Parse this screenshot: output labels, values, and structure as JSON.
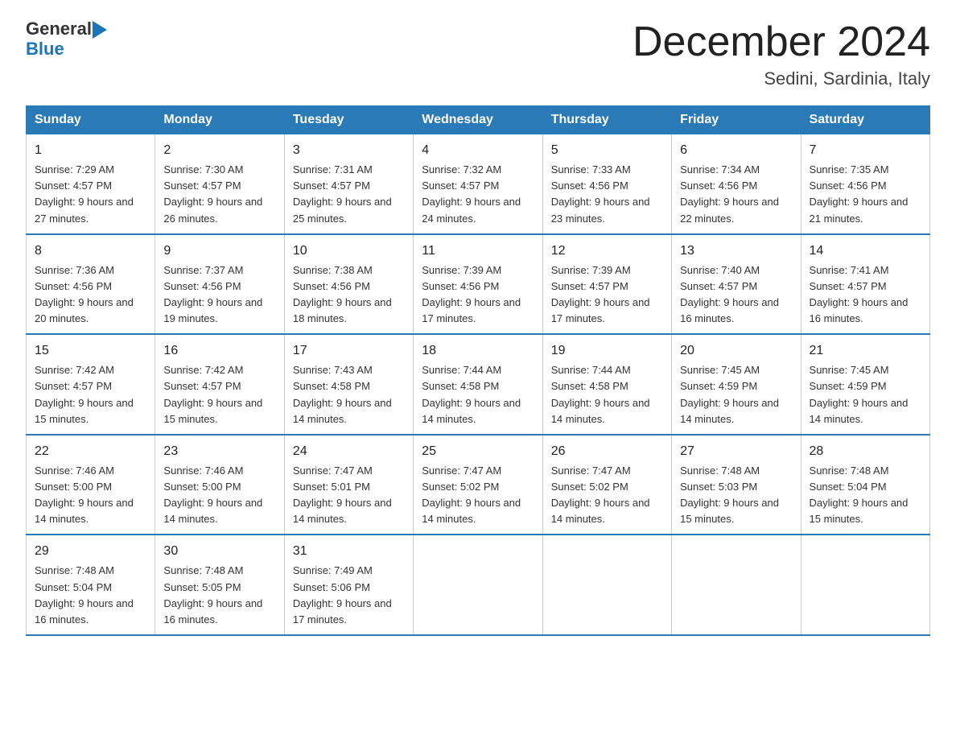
{
  "logo": {
    "general": "General",
    "blue": "Blue",
    "arrow": "▶"
  },
  "title": "December 2024",
  "subtitle": "Sedini, Sardinia, Italy",
  "weekdays": [
    "Sunday",
    "Monday",
    "Tuesday",
    "Wednesday",
    "Thursday",
    "Friday",
    "Saturday"
  ],
  "weeks": [
    [
      {
        "day": "1",
        "sunrise": "Sunrise: 7:29 AM",
        "sunset": "Sunset: 4:57 PM",
        "daylight": "Daylight: 9 hours and 27 minutes."
      },
      {
        "day": "2",
        "sunrise": "Sunrise: 7:30 AM",
        "sunset": "Sunset: 4:57 PM",
        "daylight": "Daylight: 9 hours and 26 minutes."
      },
      {
        "day": "3",
        "sunrise": "Sunrise: 7:31 AM",
        "sunset": "Sunset: 4:57 PM",
        "daylight": "Daylight: 9 hours and 25 minutes."
      },
      {
        "day": "4",
        "sunrise": "Sunrise: 7:32 AM",
        "sunset": "Sunset: 4:57 PM",
        "daylight": "Daylight: 9 hours and 24 minutes."
      },
      {
        "day": "5",
        "sunrise": "Sunrise: 7:33 AM",
        "sunset": "Sunset: 4:56 PM",
        "daylight": "Daylight: 9 hours and 23 minutes."
      },
      {
        "day": "6",
        "sunrise": "Sunrise: 7:34 AM",
        "sunset": "Sunset: 4:56 PM",
        "daylight": "Daylight: 9 hours and 22 minutes."
      },
      {
        "day": "7",
        "sunrise": "Sunrise: 7:35 AM",
        "sunset": "Sunset: 4:56 PM",
        "daylight": "Daylight: 9 hours and 21 minutes."
      }
    ],
    [
      {
        "day": "8",
        "sunrise": "Sunrise: 7:36 AM",
        "sunset": "Sunset: 4:56 PM",
        "daylight": "Daylight: 9 hours and 20 minutes."
      },
      {
        "day": "9",
        "sunrise": "Sunrise: 7:37 AM",
        "sunset": "Sunset: 4:56 PM",
        "daylight": "Daylight: 9 hours and 19 minutes."
      },
      {
        "day": "10",
        "sunrise": "Sunrise: 7:38 AM",
        "sunset": "Sunset: 4:56 PM",
        "daylight": "Daylight: 9 hours and 18 minutes."
      },
      {
        "day": "11",
        "sunrise": "Sunrise: 7:39 AM",
        "sunset": "Sunset: 4:56 PM",
        "daylight": "Daylight: 9 hours and 17 minutes."
      },
      {
        "day": "12",
        "sunrise": "Sunrise: 7:39 AM",
        "sunset": "Sunset: 4:57 PM",
        "daylight": "Daylight: 9 hours and 17 minutes."
      },
      {
        "day": "13",
        "sunrise": "Sunrise: 7:40 AM",
        "sunset": "Sunset: 4:57 PM",
        "daylight": "Daylight: 9 hours and 16 minutes."
      },
      {
        "day": "14",
        "sunrise": "Sunrise: 7:41 AM",
        "sunset": "Sunset: 4:57 PM",
        "daylight": "Daylight: 9 hours and 16 minutes."
      }
    ],
    [
      {
        "day": "15",
        "sunrise": "Sunrise: 7:42 AM",
        "sunset": "Sunset: 4:57 PM",
        "daylight": "Daylight: 9 hours and 15 minutes."
      },
      {
        "day": "16",
        "sunrise": "Sunrise: 7:42 AM",
        "sunset": "Sunset: 4:57 PM",
        "daylight": "Daylight: 9 hours and 15 minutes."
      },
      {
        "day": "17",
        "sunrise": "Sunrise: 7:43 AM",
        "sunset": "Sunset: 4:58 PM",
        "daylight": "Daylight: 9 hours and 14 minutes."
      },
      {
        "day": "18",
        "sunrise": "Sunrise: 7:44 AM",
        "sunset": "Sunset: 4:58 PM",
        "daylight": "Daylight: 9 hours and 14 minutes."
      },
      {
        "day": "19",
        "sunrise": "Sunrise: 7:44 AM",
        "sunset": "Sunset: 4:58 PM",
        "daylight": "Daylight: 9 hours and 14 minutes."
      },
      {
        "day": "20",
        "sunrise": "Sunrise: 7:45 AM",
        "sunset": "Sunset: 4:59 PM",
        "daylight": "Daylight: 9 hours and 14 minutes."
      },
      {
        "day": "21",
        "sunrise": "Sunrise: 7:45 AM",
        "sunset": "Sunset: 4:59 PM",
        "daylight": "Daylight: 9 hours and 14 minutes."
      }
    ],
    [
      {
        "day": "22",
        "sunrise": "Sunrise: 7:46 AM",
        "sunset": "Sunset: 5:00 PM",
        "daylight": "Daylight: 9 hours and 14 minutes."
      },
      {
        "day": "23",
        "sunrise": "Sunrise: 7:46 AM",
        "sunset": "Sunset: 5:00 PM",
        "daylight": "Daylight: 9 hours and 14 minutes."
      },
      {
        "day": "24",
        "sunrise": "Sunrise: 7:47 AM",
        "sunset": "Sunset: 5:01 PM",
        "daylight": "Daylight: 9 hours and 14 minutes."
      },
      {
        "day": "25",
        "sunrise": "Sunrise: 7:47 AM",
        "sunset": "Sunset: 5:02 PM",
        "daylight": "Daylight: 9 hours and 14 minutes."
      },
      {
        "day": "26",
        "sunrise": "Sunrise: 7:47 AM",
        "sunset": "Sunset: 5:02 PM",
        "daylight": "Daylight: 9 hours and 14 minutes."
      },
      {
        "day": "27",
        "sunrise": "Sunrise: 7:48 AM",
        "sunset": "Sunset: 5:03 PM",
        "daylight": "Daylight: 9 hours and 15 minutes."
      },
      {
        "day": "28",
        "sunrise": "Sunrise: 7:48 AM",
        "sunset": "Sunset: 5:04 PM",
        "daylight": "Daylight: 9 hours and 15 minutes."
      }
    ],
    [
      {
        "day": "29",
        "sunrise": "Sunrise: 7:48 AM",
        "sunset": "Sunset: 5:04 PM",
        "daylight": "Daylight: 9 hours and 16 minutes."
      },
      {
        "day": "30",
        "sunrise": "Sunrise: 7:48 AM",
        "sunset": "Sunset: 5:05 PM",
        "daylight": "Daylight: 9 hours and 16 minutes."
      },
      {
        "day": "31",
        "sunrise": "Sunrise: 7:49 AM",
        "sunset": "Sunset: 5:06 PM",
        "daylight": "Daylight: 9 hours and 17 minutes."
      },
      null,
      null,
      null,
      null
    ]
  ]
}
